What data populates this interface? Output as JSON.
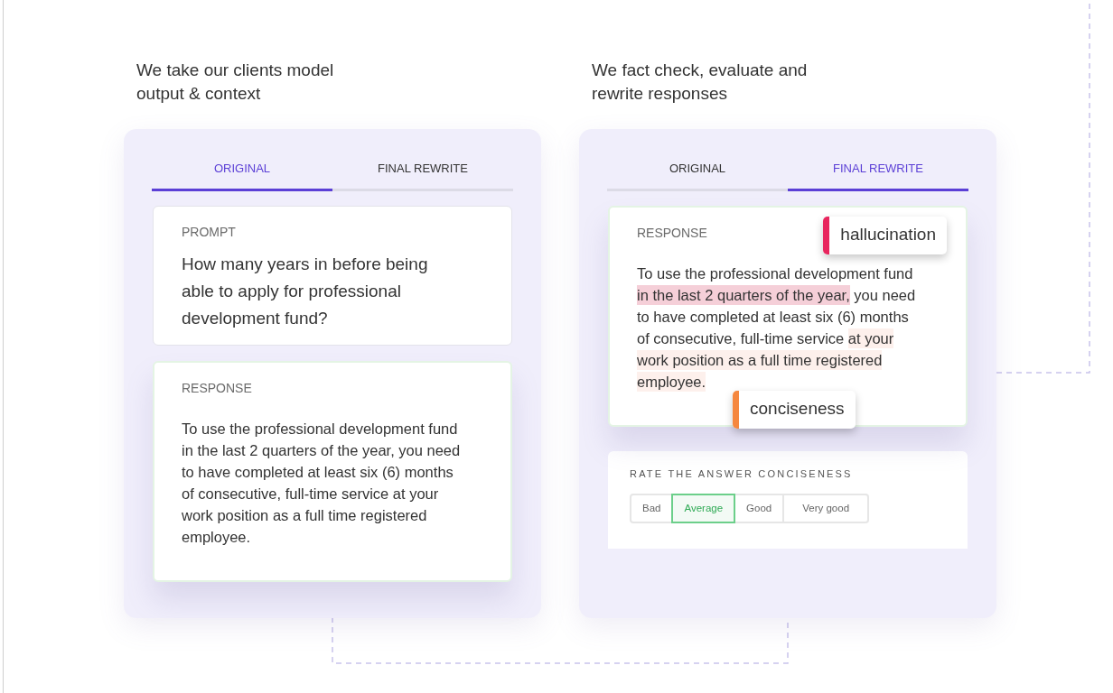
{
  "panels": [
    {
      "caption": "We take our clients model output & context",
      "tabs": [
        {
          "label": "ORIGINAL",
          "selected": true
        },
        {
          "label": "FINAL REWRITE",
          "selected": false
        }
      ],
      "cards": [
        {
          "kind": "prompt",
          "label": "PROMPT",
          "text": "How many years in before being able to apply for professional development fund?"
        },
        {
          "kind": "response",
          "label": "RESPONSE",
          "segments": [
            {
              "text": "To use the professional development fund in the last 2 quarters of the year, you need to have completed at least six (6) months of consecutive, full-time service at your work position as a full time registered employee."
            }
          ]
        }
      ]
    },
    {
      "caption": "We fact check, evaluate and rewrite responses",
      "tabs": [
        {
          "label": "ORIGINAL",
          "selected": false
        },
        {
          "label": "FINAL REWRITE",
          "selected": true
        }
      ],
      "cards": [
        {
          "kind": "response",
          "label": "RESPONSE",
          "segments": [
            {
              "text": "To use the professional development fund "
            },
            {
              "text": "in the last 2 quarters of the year,",
              "color": "#f5cfd8"
            },
            {
              "text": " you need to have completed at least six (6) months of consecutive, full-time service "
            },
            {
              "text": "at your work position as a full time registered employee.",
              "color": "#fdf0ec"
            }
          ],
          "tags": [
            {
              "label": "hallucination",
              "color": "#e8265e"
            },
            {
              "label": "conciseness",
              "color": "#f5873f"
            }
          ]
        },
        {
          "kind": "rating",
          "label": "RATE THE ANSWER CONCISENESS",
          "options": [
            {
              "label": "Bad",
              "selected": false
            },
            {
              "label": "Average",
              "selected": true
            },
            {
              "label": "Good",
              "selected": false
            },
            {
              "label": "Very good",
              "selected": false
            }
          ]
        }
      ]
    }
  ]
}
